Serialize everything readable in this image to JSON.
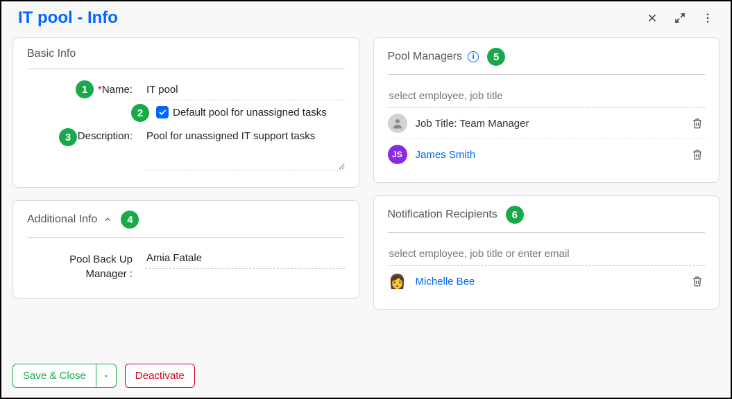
{
  "header": {
    "title": "IT pool - Info"
  },
  "basic_info": {
    "section_title": "Basic Info",
    "name_label": "Name:",
    "name_value": "IT pool",
    "checkbox_label": "Default pool for unassigned tasks",
    "description_label": "Description:",
    "description_value": "Pool for unassigned IT support tasks"
  },
  "additional_info": {
    "section_title": "Additional Info",
    "backup_label": "Pool Back Up Manager :",
    "backup_value": "Amia Fatale"
  },
  "pool_managers": {
    "section_title": "Pool Managers",
    "placeholder": "select employee, job title",
    "items": [
      {
        "label": "Job Title: Team Manager",
        "is_link": false,
        "avatar_type": "generic",
        "avatar_text": ""
      },
      {
        "label": "James Smith",
        "is_link": true,
        "avatar_type": "purple",
        "avatar_text": "JS"
      }
    ]
  },
  "notification": {
    "section_title": "Notification Recipients",
    "placeholder": "select employee, job title or enter email",
    "items": [
      {
        "label": "Michelle Bee",
        "is_link": true,
        "avatar_type": "emoji",
        "avatar_text": "👩"
      }
    ]
  },
  "footer": {
    "save_label": "Save & Close",
    "deactivate_label": "Deactivate"
  },
  "badges": {
    "b1": "1",
    "b2": "2",
    "b3": "3",
    "b4": "4",
    "b5": "5",
    "b6": "6"
  }
}
